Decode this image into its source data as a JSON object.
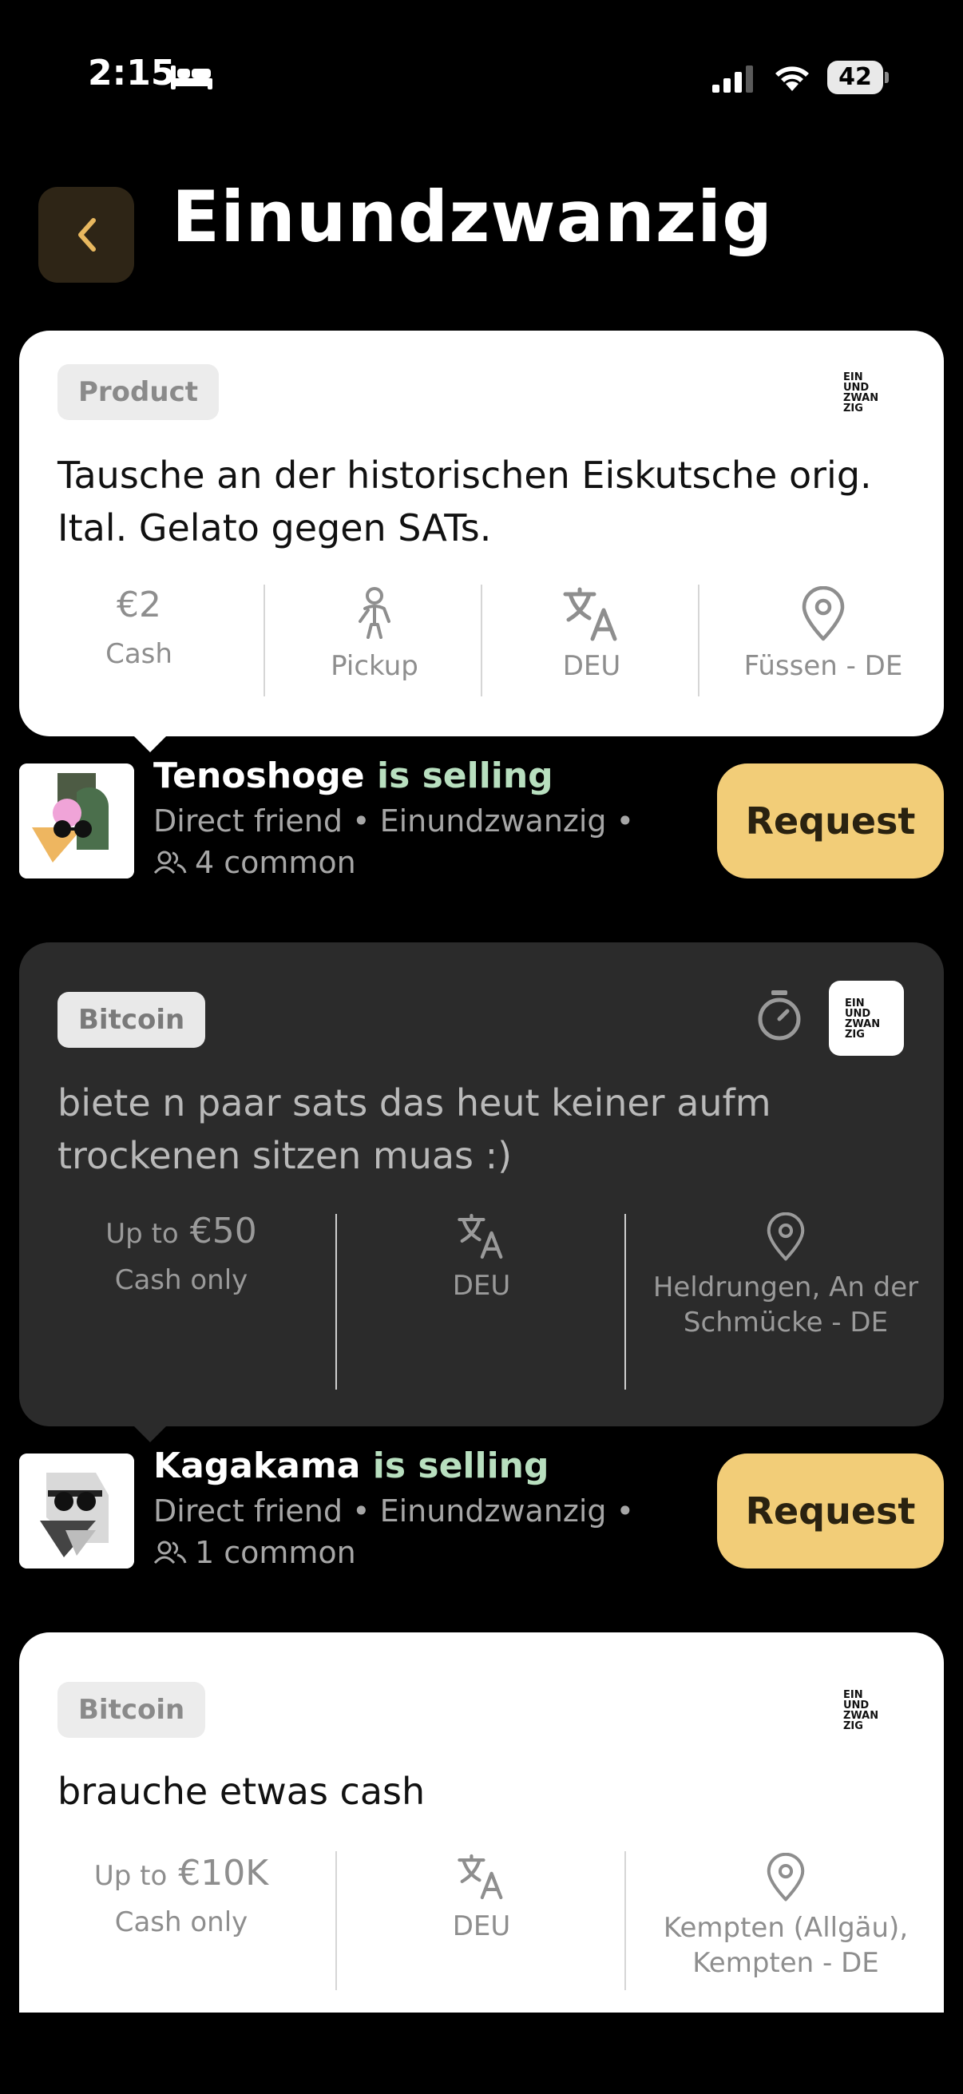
{
  "status_bar": {
    "time": "2:15",
    "battery": "42"
  },
  "header": {
    "title": "Einundzwanzig"
  },
  "logo_lines": [
    "EIN",
    "UND",
    "ZWAN",
    "ZIG"
  ],
  "offers": [
    {
      "tag": "Product",
      "text": "Tausche an der historischen Eiskutsche orig. Ital. Gelato  gegen SATs.",
      "stats": [
        {
          "value": "€2",
          "label": "Cash",
          "icon": "euro-icon"
        },
        {
          "value": "",
          "label": "Pickup",
          "icon": "person-icon"
        },
        {
          "value": "",
          "label": "DEU",
          "icon": "translate-icon"
        },
        {
          "value": "",
          "label": "Füssen - DE",
          "icon": "location-pin-icon"
        }
      ],
      "seller": {
        "name": "Tenoshoge",
        "action": "is selling",
        "relation": "Direct friend • Einundzwanzig •",
        "common": "4 common",
        "button": "Request"
      }
    },
    {
      "tag": "Bitcoin",
      "text": "biete n paar sats das heut keiner aufm trockenen sitzen muas :)",
      "stats": [
        {
          "prefix": "Up to",
          "value": "€50",
          "label": "Cash only"
        },
        {
          "label": "DEU",
          "icon": "translate-icon"
        },
        {
          "label": "Heldrungen, An der Schmücke - DE",
          "icon": "location-pin-icon"
        }
      ],
      "seller": {
        "name": "Kagakama",
        "action": "is selling",
        "relation": "Direct friend • Einundzwanzig •",
        "common": "1 common",
        "button": "Request"
      }
    },
    {
      "tag": "Bitcoin",
      "text": "brauche etwas cash",
      "stats": [
        {
          "prefix": "Up to",
          "value": "€10K",
          "label": "Cash only"
        },
        {
          "label": "DEU",
          "icon": "translate-icon"
        },
        {
          "label": "Kempten (Allgäu), Kempten - DE",
          "icon": "location-pin-icon"
        }
      ]
    }
  ],
  "colors": {
    "accent": "#f2cd78",
    "selling": "#b8dfbf",
    "dark_card": "#2b2b2b"
  }
}
